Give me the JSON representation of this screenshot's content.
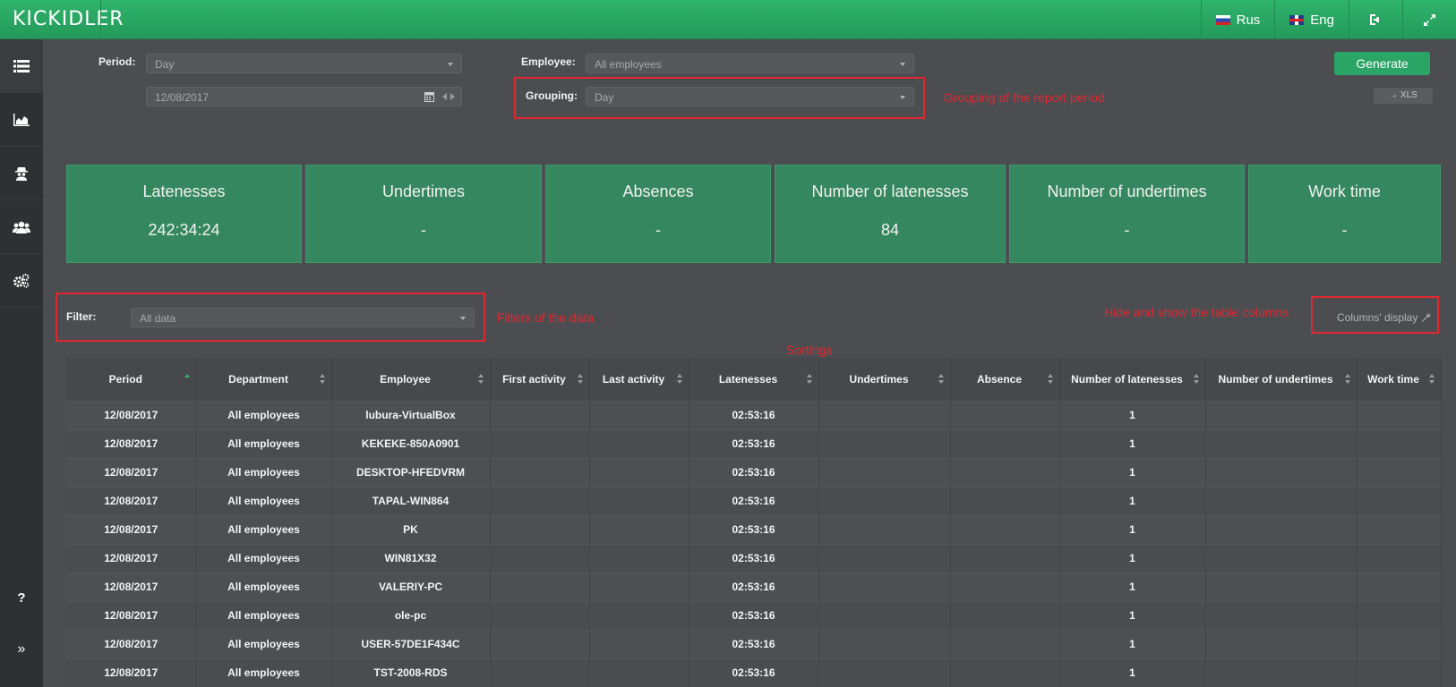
{
  "app": {
    "logo": "KICKIDLER"
  },
  "topnav": {
    "rus": "Rus",
    "eng": "Eng"
  },
  "filters": {
    "period_label": "Period:",
    "period_value": "Day",
    "date_value": "12/08/2017",
    "employee_label": "Employee:",
    "employee_value": "All employees",
    "grouping_label": "Grouping:",
    "grouping_value": "Day",
    "filter_label": "Filter:",
    "filter_value": "All data"
  },
  "buttons": {
    "generate": "Generate",
    "xls": "→ XLS",
    "columns_display": "Columns' display"
  },
  "annotations": {
    "grouping": "Grouping of the report period",
    "filters": "Filters of the data",
    "sortings": "Sortings",
    "columns": "Hide and show the table columns"
  },
  "cards": [
    {
      "title": "Latenesses",
      "value": "242:34:24"
    },
    {
      "title": "Undertimes",
      "value": "-"
    },
    {
      "title": "Absences",
      "value": "-"
    },
    {
      "title": "Number of latenesses",
      "value": "84"
    },
    {
      "title": "Number of undertimes",
      "value": "-"
    },
    {
      "title": "Work time",
      "value": "-"
    }
  ],
  "table": {
    "columns": [
      "Period",
      "Department",
      "Employee",
      "First activity",
      "Last activity",
      "Latenesses",
      "Undertimes",
      "Absence",
      "Number of latenesses",
      "Number of undertimes",
      "Work time"
    ],
    "rows": [
      [
        "12/08/2017",
        "All employees",
        "lubura-VirtualBox",
        "",
        "",
        "02:53:16",
        "",
        "",
        "1",
        "",
        ""
      ],
      [
        "12/08/2017",
        "All employees",
        "KEKEKE-850A0901",
        "",
        "",
        "02:53:16",
        "",
        "",
        "1",
        "",
        ""
      ],
      [
        "12/08/2017",
        "All employees",
        "DESKTOP-HFEDVRM",
        "",
        "",
        "02:53:16",
        "",
        "",
        "1",
        "",
        ""
      ],
      [
        "12/08/2017",
        "All employees",
        "TAPAL-WIN864",
        "",
        "",
        "02:53:16",
        "",
        "",
        "1",
        "",
        ""
      ],
      [
        "12/08/2017",
        "All employees",
        "PK",
        "",
        "",
        "02:53:16",
        "",
        "",
        "1",
        "",
        ""
      ],
      [
        "12/08/2017",
        "All employees",
        "WIN81X32",
        "",
        "",
        "02:53:16",
        "",
        "",
        "1",
        "",
        ""
      ],
      [
        "12/08/2017",
        "All employees",
        "VALERIY-PC",
        "",
        "",
        "02:53:16",
        "",
        "",
        "1",
        "",
        ""
      ],
      [
        "12/08/2017",
        "All employees",
        "ole-pc",
        "",
        "",
        "02:53:16",
        "",
        "",
        "1",
        "",
        ""
      ],
      [
        "12/08/2017",
        "All employees",
        "USER-57DE1F434C",
        "",
        "",
        "02:53:16",
        "",
        "",
        "1",
        "",
        ""
      ],
      [
        "12/08/2017",
        "All employees",
        "TST-2008-RDS",
        "",
        "",
        "02:53:16",
        "",
        "",
        "1",
        "",
        ""
      ]
    ]
  }
}
